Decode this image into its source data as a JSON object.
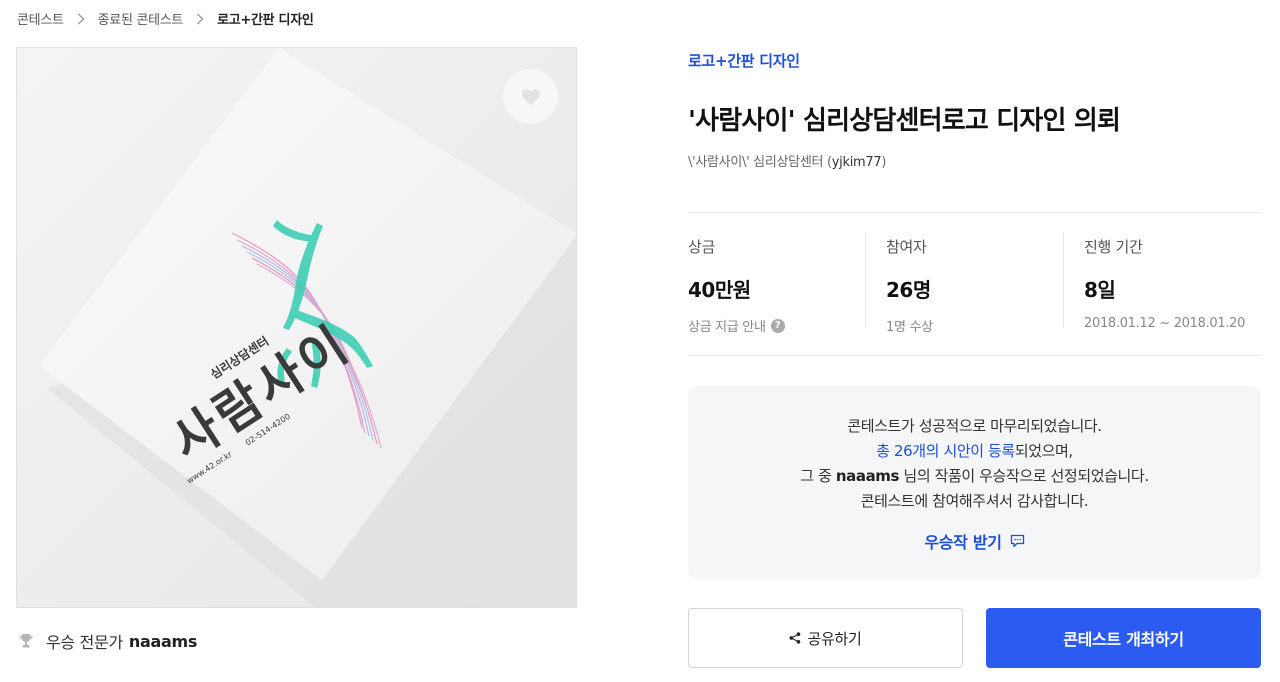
{
  "breadcrumb": {
    "items": [
      "콘테스트",
      "종료된 콘테스트",
      "로고+간판 디자인"
    ]
  },
  "artwork": {
    "brand_name": "사람사이",
    "brand_sub": "심리상담센터",
    "website": "www.42.or.kr",
    "phone": "02-514-4200"
  },
  "winner": {
    "label": "우승 전문가",
    "name": "naaams"
  },
  "contest": {
    "category": "로고+간판 디자인",
    "title": "'사람사이' 심리상담센터로고 디자인 의뢰",
    "client_name": "\\'사람사이\\' 심리상담센터",
    "client_id": "yjkim77"
  },
  "stats": [
    {
      "label": "상금",
      "value": "40만원",
      "sub": "상금 지급 안내"
    },
    {
      "label": "참여자",
      "value": "26명",
      "sub": "1명 수상"
    },
    {
      "label": "진행 기간",
      "value": "8일",
      "sub": "2018.01.12 ~ 2018.01.20"
    }
  ],
  "result": {
    "line1": "콘테스트가 성공적으로 마무리되었습니다.",
    "line2_link": "총 26개의 시안이 등록",
    "line2_rest": "되었으며,",
    "line3_pre": "그 중",
    "line3_name": "naaams",
    "line3_post": "님의 작품이 우승작으로 선정되었습니다.",
    "line4": "콘테스트에 참여해주셔서 감사합니다.",
    "receive_label": "우승작 받기"
  },
  "buttons": {
    "share": "공유하기",
    "host": "콘테스트 개최하기"
  },
  "colors": {
    "accent": "#2b5bf0",
    "link": "#1d4fd8",
    "teal": "#3fcfb4",
    "pink": "#e88ab8"
  }
}
